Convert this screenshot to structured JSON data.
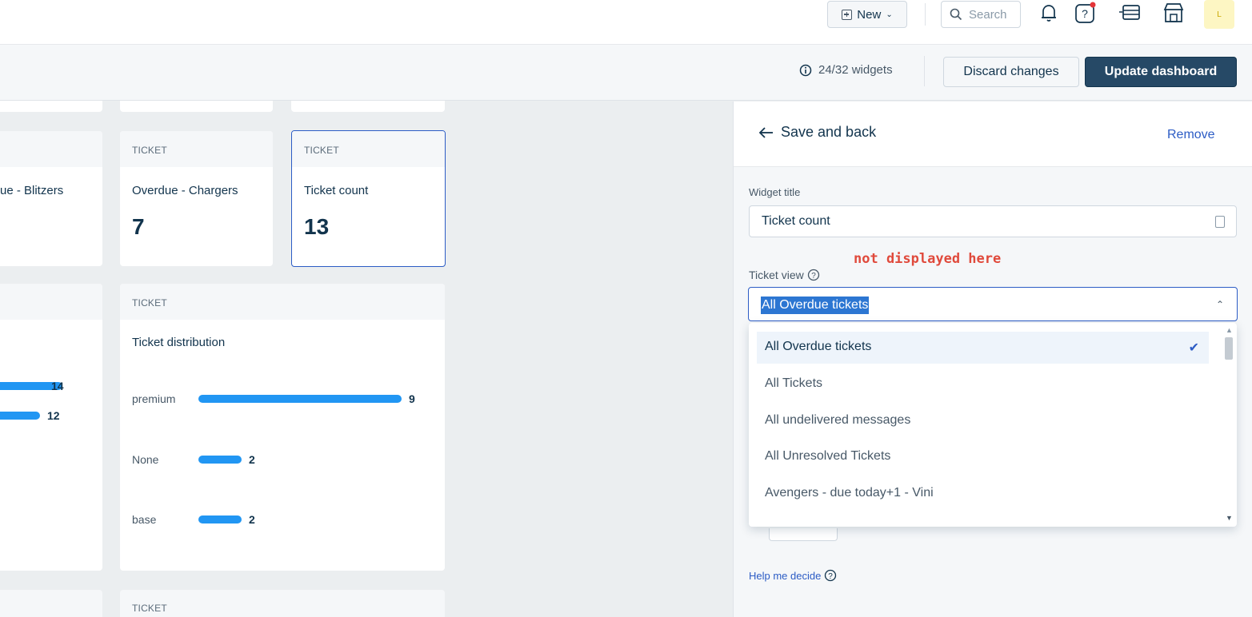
{
  "header": {
    "new_label": "New",
    "search_placeholder": "Search",
    "avatar_initial": "L",
    "icons": [
      "plus-square-icon",
      "chevron-down-icon",
      "search-icon",
      "bell-icon",
      "help-icon",
      "apps-icon",
      "store-icon"
    ],
    "notification_dot_color": "#e43538"
  },
  "subheader": {
    "widget_count": "24/32 widgets",
    "discard_label": "Discard changes",
    "update_label": "Update dashboard"
  },
  "cards": {
    "blitzers": {
      "title_partial": "ue - Blitzers"
    },
    "chargers": {
      "head": "TICKET",
      "title": "Overdue - Chargers",
      "value": "7"
    },
    "ticket_count": {
      "head": "TICKET",
      "title": "Ticket count",
      "value": "13"
    },
    "left_distribution": {
      "values": [
        "14",
        "12"
      ]
    },
    "distribution": {
      "head": "TICKET",
      "title": "Ticket distribution",
      "rows": [
        {
          "label": "premium",
          "value": "9"
        },
        {
          "label": "None",
          "value": "2"
        },
        {
          "label": "base",
          "value": "2"
        }
      ]
    },
    "bottom_card": {
      "head": "TICKET"
    }
  },
  "panel": {
    "back_label": "Save and back",
    "remove_label": "Remove",
    "widget_title_label": "Widget title",
    "widget_title_value": "Ticket count",
    "annotation": "not displayed here",
    "ticket_view_label": "Ticket view",
    "ticket_view_selected": "All Overdue tickets",
    "options": [
      "All Overdue tickets",
      "All Tickets",
      "All undelivered messages",
      "All Unresolved Tickets",
      "Avengers - due today+1 - Vini"
    ],
    "help_label": "Help me decide",
    "accent_color": "#2c5cc5",
    "primary_button_color": "#264966"
  }
}
